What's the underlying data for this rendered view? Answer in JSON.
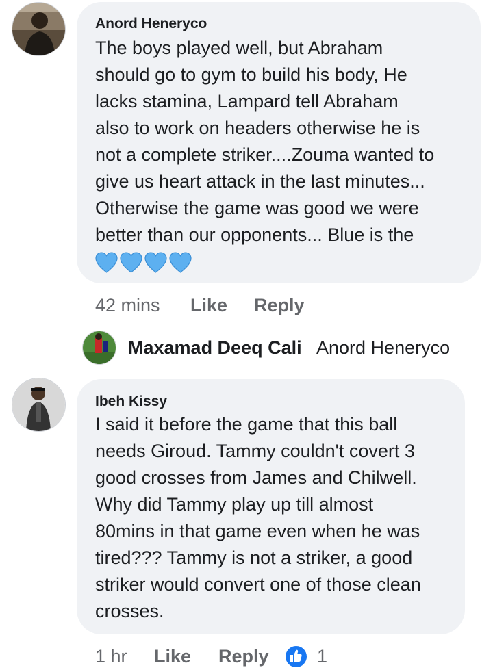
{
  "comments": [
    {
      "author": "Anord Heneryco",
      "lines": [
        "The boys played well, but Abraham",
        "should go to gym to build his body, He",
        "lacks stamina, Lampard tell Abraham",
        "also to work on headers otherwise he is",
        "not a complete striker....Zouma wanted to",
        "give us heart attack in the last minutes...",
        "Otherwise the game was good we were",
        "better than our opponents... Blue is the"
      ],
      "emoji_icons": [
        "blue-heart-icon",
        "blue-heart-icon",
        "blue-heart-icon",
        "blue-heart-icon"
      ],
      "timestamp": "42 mins",
      "like_label": "Like",
      "reply_label": "Reply"
    },
    {
      "author": "Ibeh Kissy",
      "lines": [
        "I said it before the game that this ball",
        "needs Giroud. Tammy couldn't covert 3",
        "good crosses from James and Chilwell.",
        "Why did Tammy play up till almost",
        "80mins in that game even when he was",
        "tired??? Tammy is not a striker, a good",
        "striker would convert one of those clean",
        "crosses."
      ],
      "timestamp": "1 hr",
      "like_label": "Like",
      "reply_label": "Reply",
      "reaction_icon": "thumbs-up-icon",
      "reaction_count": "1"
    }
  ],
  "reply_preview": {
    "author": "Maxamad Deeq Cali",
    "snippet": "Anord Heneryco"
  },
  "colors": {
    "bubble": "#f0f2f5",
    "meta_text": "#65676b",
    "like_blue": "#1877f2",
    "heart_blue": "#5db0f0"
  }
}
